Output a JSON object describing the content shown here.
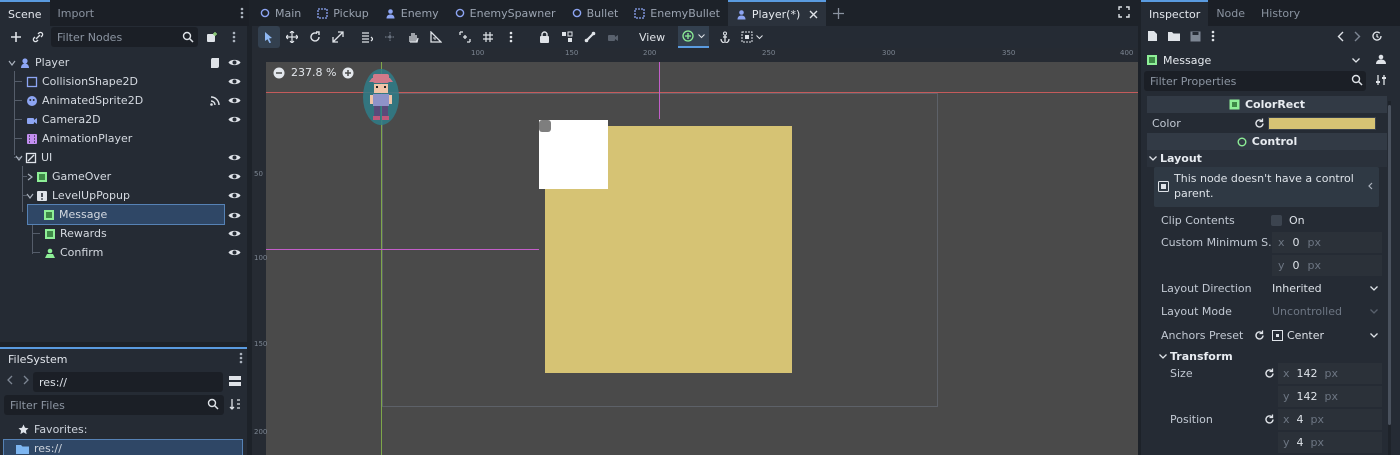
{
  "scene_dock": {
    "tabs": [
      {
        "label": "Scene",
        "active": true
      },
      {
        "label": "Import",
        "active": false
      }
    ],
    "filter_placeholder": "Filter Nodes",
    "nodes": [
      {
        "label": "Player",
        "icon": "node2d-icon",
        "depth": 0
      },
      {
        "label": "CollisionShape2D",
        "icon": "collision-shape-icon",
        "depth": 1
      },
      {
        "label": "AnimatedSprite2D",
        "icon": "animated-sprite-icon",
        "depth": 1
      },
      {
        "label": "Camera2D",
        "icon": "camera-icon",
        "depth": 1
      },
      {
        "label": "AnimationPlayer",
        "icon": "animation-player-icon",
        "depth": 1
      },
      {
        "label": "UI",
        "icon": "canvas-layer-icon",
        "depth": 1
      },
      {
        "label": "GameOver",
        "icon": "color-rect-icon",
        "depth": 2
      },
      {
        "label": "LevelUpPopup",
        "icon": "panel-icon",
        "depth": 2
      },
      {
        "label": "Message",
        "icon": "color-rect-icon",
        "depth": 3,
        "selected": true
      },
      {
        "label": "Rewards",
        "icon": "color-rect-icon",
        "depth": 3
      },
      {
        "label": "Confirm",
        "icon": "button-icon",
        "depth": 3
      }
    ]
  },
  "filesystem": {
    "title": "FileSystem",
    "path": "res://",
    "filter_placeholder": "Filter Files",
    "favorites_label": "Favorites:",
    "root_label": "res://"
  },
  "editor": {
    "tabs": [
      {
        "label": "Main",
        "icon": "circle-icon"
      },
      {
        "label": "Pickup",
        "icon": "node-icon"
      },
      {
        "label": "Enemy",
        "icon": "character-icon"
      },
      {
        "label": "EnemySpawner",
        "icon": "circle-icon"
      },
      {
        "label": "Bullet",
        "icon": "circle-icon"
      },
      {
        "label": "EnemyBullet",
        "icon": "node-icon"
      },
      {
        "label": "Player(*)",
        "icon": "character-icon",
        "active": true
      }
    ],
    "view_label": "View",
    "zoom": "237.8 %",
    "ruler_top": [
      "50",
      "100",
      "150",
      "200",
      "250",
      "300",
      "350",
      "400"
    ],
    "ruler_left": [
      "50",
      "100",
      "150",
      "200"
    ],
    "rect_color": "#d6c374"
  },
  "inspector": {
    "tabs": [
      {
        "label": "Inspector",
        "active": true
      },
      {
        "label": "Node",
        "active": false
      },
      {
        "label": "History",
        "active": false
      }
    ],
    "node_name": "Message",
    "filter_placeholder": "Filter Properties",
    "colorrect_section": "ColorRect",
    "color_label": "Color",
    "color_value": "#d6c374",
    "control_section": "Control",
    "layout_label": "Layout",
    "warning": "This node doesn't have a control parent.",
    "clip_contents_label": "Clip Contents",
    "clip_contents_value": "On",
    "custom_min_label": "Custom Minimum S...",
    "custom_min_x": "0",
    "custom_min_y": "0",
    "unit": "px",
    "layout_direction_label": "Layout Direction",
    "layout_direction_value": "Inherited",
    "layout_mode_label": "Layout Mode",
    "layout_mode_value": "Uncontrolled",
    "anchors_preset_label": "Anchors Preset",
    "anchors_preset_value": "Center",
    "transform_label": "Transform",
    "size_label": "Size",
    "size_x": "142",
    "size_y": "142",
    "position_label": "Position",
    "position_x": "4",
    "position_y": "4",
    "axis_x": "x",
    "axis_y": "y"
  }
}
